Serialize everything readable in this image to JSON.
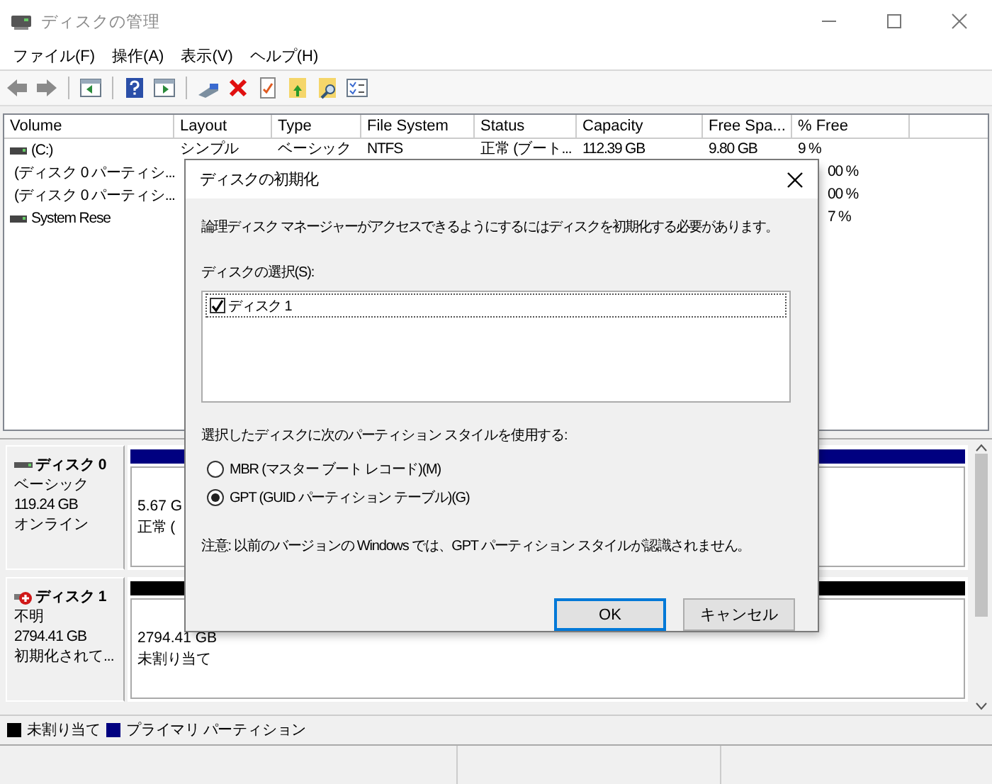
{
  "window": {
    "title": "ディスクの管理"
  },
  "menu": [
    "ファイル(F)",
    "操作(A)",
    "表示(V)",
    "ヘルプ(H)"
  ],
  "volumes": {
    "columns": [
      {
        "label": "Volume"
      },
      {
        "label": "Layout"
      },
      {
        "label": "Type"
      },
      {
        "label": "File System"
      },
      {
        "label": "Status"
      },
      {
        "label": "Capacity"
      },
      {
        "label": "Free Spa..."
      },
      {
        "label": "% Free"
      }
    ],
    "rows": [
      {
        "kind": "full",
        "cells": [
          "(C:)",
          "シンプル",
          "ベーシック",
          "NTFS",
          "正常 (ブート...",
          "112.39 GB",
          "9.80 GB",
          "9 %"
        ]
      },
      {
        "kind": "covered",
        "cells": [
          "(ディスク 0 パーティシ...",
          null,
          null,
          null,
          null,
          null,
          null,
          "00 %"
        ]
      },
      {
        "kind": "covered",
        "cells": [
          "(ディスク 0 パーティシ...",
          null,
          null,
          null,
          null,
          null,
          null,
          "00 %"
        ]
      },
      {
        "kind": "covered",
        "cells": [
          "System Rese",
          null,
          null,
          null,
          null,
          null,
          null,
          "7 %"
        ]
      }
    ]
  },
  "disks": [
    {
      "name": "ディスク 0",
      "type": "ベーシック",
      "size": "119.24 GB",
      "status": "オンライン",
      "error": false,
      "partition": {
        "kind": "primary",
        "size": "5.67 G",
        "status": "正常 ("
      }
    },
    {
      "name": "ディスク 1",
      "type": "不明",
      "size": "2794.41 GB",
      "status": "初期化されて...",
      "error": true,
      "partition": {
        "kind": "unallocated",
        "size": "2794.41 GB",
        "status": "未割り当て"
      }
    }
  ],
  "legend": [
    {
      "label": "未割り当て",
      "color": "#000000"
    },
    {
      "label": "プライマリ パーティション",
      "color": "#000080"
    }
  ],
  "dialog": {
    "title": "ディスクの初期化",
    "message": "論理ディスク マネージャーがアクセスできるようにするにはディスクを初期化する必要があります。",
    "select_label": "ディスクの選択(S):",
    "disks": [
      {
        "label": "ディスク 1",
        "checked": true
      }
    ],
    "style_label": "選択したディスクに次のパーティション スタイルを使用する:",
    "options": [
      {
        "label": "MBR (マスター ブート レコード)(M)",
        "selected": false
      },
      {
        "label": "GPT (GUID パーティション テーブル)(G)",
        "selected": true
      }
    ],
    "note": "注意: 以前のバージョンの Windows では、GPT パーティション スタイルが認識されません。",
    "buttons": [
      {
        "label": "OK",
        "default": true
      },
      {
        "label": "キャンセル",
        "default": false
      }
    ]
  }
}
